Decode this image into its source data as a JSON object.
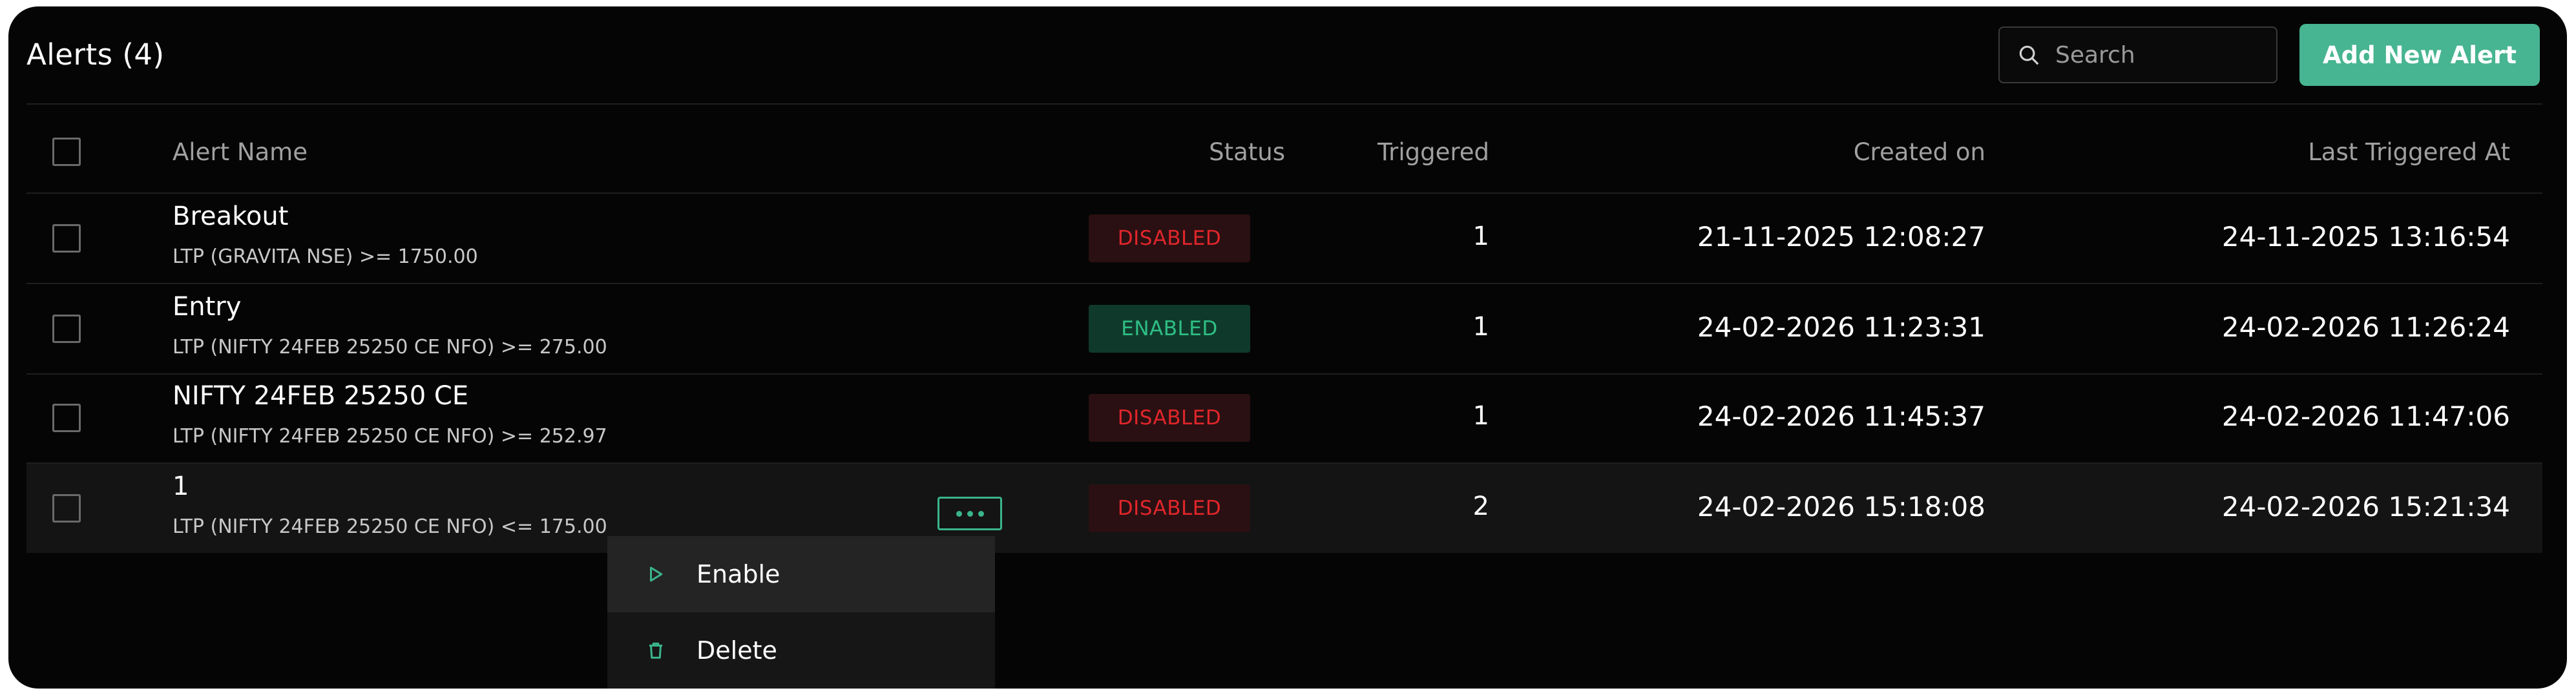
{
  "header": {
    "title": "Alerts (4)",
    "search_placeholder": "Search",
    "add_button_label": "Add New Alert"
  },
  "colors": {
    "accent": "#47b591",
    "disabled_text": "#e0262b",
    "enabled_text": "#2fbf85",
    "background": "#050505"
  },
  "columns": {
    "name": "Alert Name",
    "status": "Status",
    "triggered": "Triggered",
    "created": "Created on",
    "last_triggered": "Last Triggered At"
  },
  "rows": [
    {
      "name": "Breakout",
      "condition": "LTP  (GRAVITA  NSE) >= 1750.00",
      "status": "DISABLED",
      "triggered": "1",
      "created": "21-11-2025 12:08:27",
      "last_triggered": "24-11-2025 13:16:54"
    },
    {
      "name": "Entry",
      "condition": "LTP  (NIFTY 24FEB 25250 CE  NFO) >= 275.00",
      "status": "ENABLED",
      "triggered": "1",
      "created": "24-02-2026 11:23:31",
      "last_triggered": "24-02-2026 11:26:24"
    },
    {
      "name": "NIFTY 24FEB 25250 CE",
      "condition": "LTP  (NIFTY 24FEB 25250 CE  NFO) >= 252.97",
      "status": "DISABLED",
      "triggered": "1",
      "created": "24-02-2026 11:45:37",
      "last_triggered": "24-02-2026 11:47:06"
    },
    {
      "name": "1",
      "condition": "LTP  (NIFTY 24FEB 25250 CE  NFO) <= 175.00",
      "status": "DISABLED",
      "triggered": "2",
      "created": "24-02-2026 15:18:08",
      "last_triggered": "24-02-2026 15:21:34"
    }
  ],
  "context_menu": {
    "enable_label": "Enable",
    "delete_label": "Delete",
    "enable_icon": "play-icon",
    "delete_icon": "trash-icon"
  }
}
